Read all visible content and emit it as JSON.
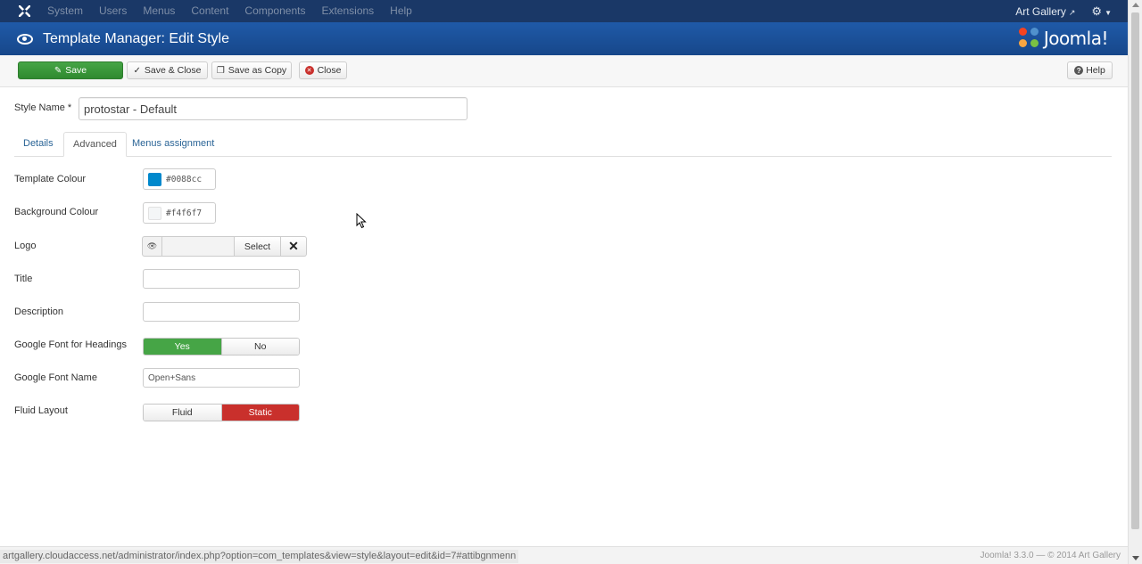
{
  "navbar": {
    "menu": [
      "System",
      "Users",
      "Menus",
      "Content",
      "Components",
      "Extensions",
      "Help"
    ],
    "site_name": "Art Gallery"
  },
  "header": {
    "title": "Template Manager: Edit Style",
    "brand": "Joomla!"
  },
  "toolbar": {
    "save": "Save",
    "save_close": "Save & Close",
    "save_copy": "Save as Copy",
    "close": "Close",
    "help": "Help"
  },
  "style_name": {
    "label": "Style Name *",
    "value": "protostar - Default"
  },
  "tabs": [
    {
      "label": "Details",
      "active": false
    },
    {
      "label": "Advanced",
      "active": true
    },
    {
      "label": "Menus assignment",
      "active": false
    }
  ],
  "form": {
    "template_colour": {
      "label": "Template Colour",
      "value": "#0088cc"
    },
    "background_colour": {
      "label": "Background Colour",
      "value": "#f4f6f7"
    },
    "logo": {
      "label": "Logo",
      "select": "Select"
    },
    "title": {
      "label": "Title",
      "value": ""
    },
    "description": {
      "label": "Description",
      "value": ""
    },
    "google_font_headings": {
      "label": "Google Font for Headings",
      "options": [
        "Yes",
        "No"
      ],
      "selected": "Yes"
    },
    "google_font_name": {
      "label": "Google Font Name",
      "value": "Open+Sans"
    },
    "fluid_layout": {
      "label": "Fluid Layout",
      "options": [
        "Fluid",
        "Static"
      ],
      "selected": "Static"
    }
  },
  "statusbar": {
    "url": "artgallery.cloudaccess.net/administrator/index.php?option=com_templates&view=style&layout=edit&id=7#attibgnmenn",
    "footer": "Joomla! 3.3.0 — © 2014 Art Gallery"
  },
  "colors": {
    "navbar": "#1a3867",
    "header": "#1f5aa8",
    "save_green": "#46a546",
    "static_red": "#c9302c",
    "template_swatch": "#0088cc",
    "background_swatch": "#f4f6f7"
  }
}
